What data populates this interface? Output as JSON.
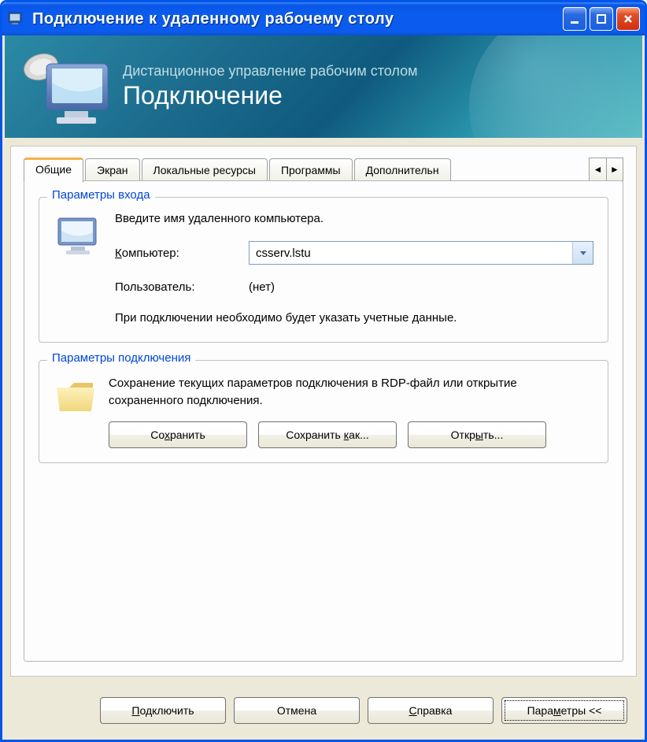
{
  "window": {
    "title": "Подключение к удаленному рабочему столу"
  },
  "banner": {
    "subtitle": "Дистанционное управление рабочим столом",
    "title": "Подключение"
  },
  "tabs": {
    "general": "Общие",
    "screen": "Экран",
    "local": "Локальные ресурсы",
    "programs": "Программы",
    "advanced": "Дополнительн"
  },
  "login_group": {
    "title": "Параметры входа",
    "instruction": "Введите имя удаленного компьютера.",
    "computer_label": "Компьютер:",
    "computer_value": "csserv.lstu",
    "user_label": "Пользователь:",
    "user_value": "(нет)",
    "note": "При подключении необходимо будет указать учетные данные."
  },
  "conn_group": {
    "title": "Параметры подключения",
    "text": "Сохранение текущих параметров подключения в RDP-файл или открытие сохраненного подключения.",
    "save": "Сохранить",
    "save_as": "Сохранить как...",
    "open": "Открыть..."
  },
  "footer": {
    "connect": "Подключить",
    "cancel": "Отмена",
    "help": "Справка",
    "options": "Параметры <<"
  }
}
